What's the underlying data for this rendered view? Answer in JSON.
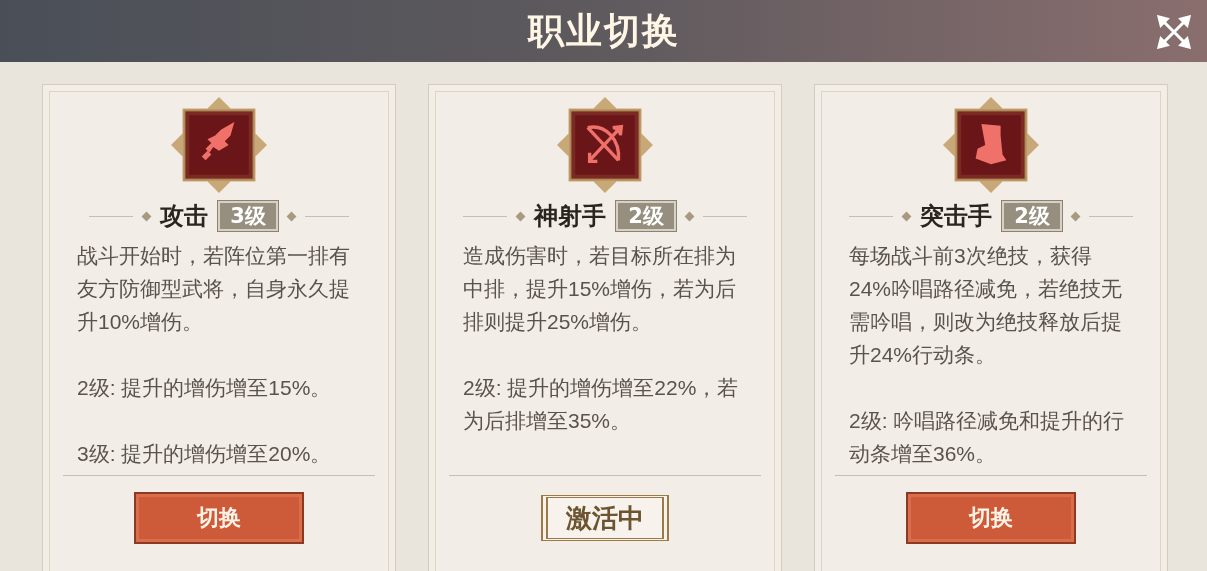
{
  "window": {
    "title": "职业切换"
  },
  "cards": [
    {
      "name": "攻击",
      "level": "3级",
      "active": false,
      "paragraphs": [
        "战斗开始时，若阵位第一排有友方防御型武将，自身永久提升10%增伤。",
        "2级: 提升的增伤增至15%。",
        "3级: 提升的增伤增至20%。"
      ],
      "action": "切换"
    },
    {
      "name": "神射手",
      "level": "2级",
      "active": true,
      "paragraphs": [
        "造成伤害时，若目标所在排为中排，提升15%增伤，若为后排则提升25%增伤。",
        "2级: 提升的增伤增至22%，若为后排增至35%。"
      ],
      "action": "激活中"
    },
    {
      "name": "突击手",
      "level": "2级",
      "active": false,
      "paragraphs": [
        "每场战斗前3次绝技，获得24%吟唱路径减免，若绝技无需吟唱，则改为绝技释放后提升24%行动条。",
        "2级: 吟唱路径减免和提升的行动条增至36%。"
      ],
      "action": "切换"
    }
  ]
}
